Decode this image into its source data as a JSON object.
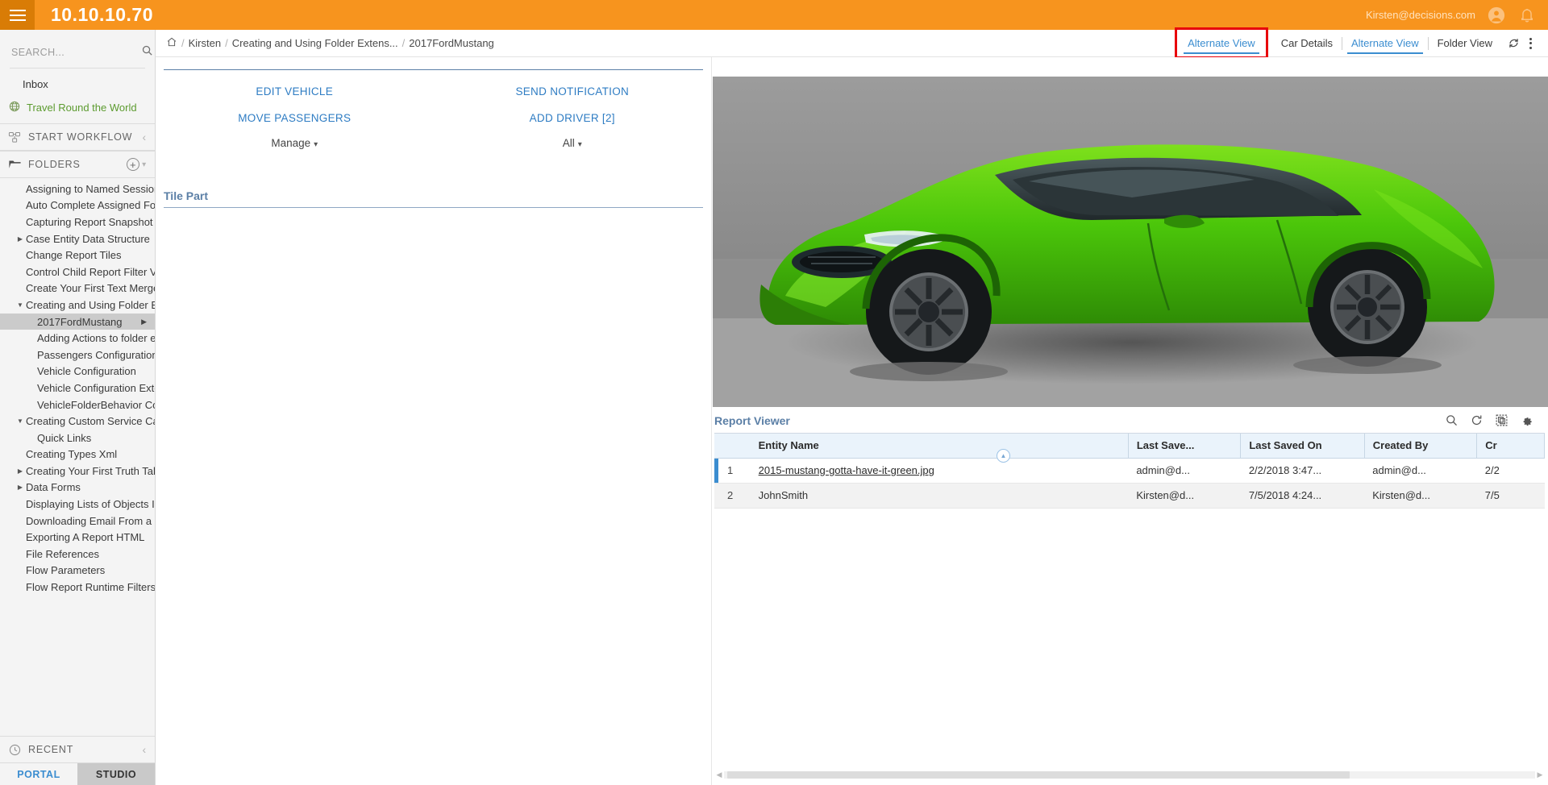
{
  "topbar": {
    "host": "10.10.10.70",
    "user_email": "Kirsten@decisions.com",
    "menu_icon": "hamburger-icon",
    "account_icon": "account-circle-icon",
    "bell_icon": "notification-bell-icon",
    "bg_color": "#F7941E"
  },
  "sidebar": {
    "search": {
      "placeholder": "SEARCH...",
      "value": ""
    },
    "inbox_label": "Inbox",
    "featured_label": "Travel Round the World",
    "start_workflow_label": "START WORKFLOW",
    "folders_label": "FOLDERS",
    "recent_label": "RECENT",
    "folders": [
      {
        "label": "Assigning to Named Sessions",
        "level": 0,
        "twisty": "",
        "selected": false
      },
      {
        "label": "Auto Complete Assigned Form",
        "level": 0,
        "twisty": "",
        "selected": false
      },
      {
        "label": "Capturing Report Snapshot",
        "level": 0,
        "twisty": "",
        "selected": false
      },
      {
        "label": "Case Entity Data Structure",
        "level": 0,
        "twisty": "collapsed",
        "selected": false
      },
      {
        "label": "Change Report Tiles",
        "level": 0,
        "twisty": "",
        "selected": false
      },
      {
        "label": "Control Child Report Filter Value",
        "level": 0,
        "twisty": "",
        "selected": false
      },
      {
        "label": "Create Your First Text Merge",
        "level": 0,
        "twisty": "",
        "selected": false
      },
      {
        "label": "Creating and Using Folder Exten",
        "level": 0,
        "twisty": "expanded",
        "selected": false
      },
      {
        "label": "2017FordMustang",
        "level": 1,
        "twisty": "",
        "selected": true,
        "right_arrow": true
      },
      {
        "label": "Adding Actions to folder entiti",
        "level": 1,
        "twisty": "",
        "selected": false
      },
      {
        "label": "Passengers Configuration",
        "level": 1,
        "twisty": "",
        "selected": false
      },
      {
        "label": "Vehicle Configuration",
        "level": 1,
        "twisty": "",
        "selected": false
      },
      {
        "label": "Vehicle Configuration Extensio",
        "level": 1,
        "twisty": "",
        "selected": false
      },
      {
        "label": "VehicleFolderBehavior Config",
        "level": 1,
        "twisty": "",
        "selected": false
      },
      {
        "label": "Creating Custom Service Catalo",
        "level": 0,
        "twisty": "expanded",
        "selected": false
      },
      {
        "label": "Quick Links",
        "level": 1,
        "twisty": "",
        "selected": false
      },
      {
        "label": "Creating Types Xml",
        "level": 0,
        "twisty": "",
        "selected": false
      },
      {
        "label": "Creating Your First Truth Table",
        "level": 0,
        "twisty": "collapsed",
        "selected": false
      },
      {
        "label": "Data Forms",
        "level": 0,
        "twisty": "collapsed",
        "selected": false
      },
      {
        "label": "Displaying Lists of Objects In A",
        "level": 0,
        "twisty": "",
        "selected": false
      },
      {
        "label": "Downloading Email From a Mail",
        "level": 0,
        "twisty": "",
        "selected": false
      },
      {
        "label": "Exporting A Report HTML",
        "level": 0,
        "twisty": "",
        "selected": false
      },
      {
        "label": "File References",
        "level": 0,
        "twisty": "",
        "selected": false
      },
      {
        "label": "Flow Parameters",
        "level": 0,
        "twisty": "",
        "selected": false
      },
      {
        "label": "Flow Report Runtime Filters",
        "level": 0,
        "twisty": "",
        "selected": false
      }
    ],
    "bottom_tabs": [
      {
        "label": "PORTAL",
        "active": true
      },
      {
        "label": "STUDIO",
        "active": false
      }
    ]
  },
  "breadcrumb": {
    "home_icon": "home-icon",
    "items": [
      "Kirsten",
      "Creating and Using Folder Extens...",
      "2017FordMustang"
    ]
  },
  "view_tabs": {
    "highlighted": {
      "label": "Alternate View",
      "highlight_color": "#E8000B"
    },
    "tabs": [
      {
        "label": "Car Details",
        "active": false
      },
      {
        "label": "Alternate View",
        "active": true
      },
      {
        "label": "Folder View",
        "active": false
      }
    ],
    "refresh_icon": "refresh-icon",
    "more_icon": "kebab-menu-icon"
  },
  "actions": {
    "left": [
      {
        "label": "EDIT VEHICLE"
      },
      {
        "label": "MOVE PASSENGERS"
      }
    ],
    "right": [
      {
        "label": "SEND NOTIFICATION"
      },
      {
        "label": "ADD DRIVER [2]"
      }
    ],
    "left_dropdown": "Manage",
    "right_dropdown": "All"
  },
  "tile_part": {
    "title": "Tile Part"
  },
  "car_image": {
    "alt_name": "green-ford-mustang-photo"
  },
  "report_viewer": {
    "title": "Report Viewer",
    "tools": [
      {
        "name": "search-icon"
      },
      {
        "name": "refresh-icon"
      },
      {
        "name": "copy-icon"
      },
      {
        "name": "gear-icon"
      }
    ],
    "columns": [
      "",
      "Entity Name",
      "Last Save...",
      "Last Saved On",
      "Created By",
      "Cr"
    ],
    "rows": [
      {
        "index": "1",
        "entity_name": "2015-mustang-gotta-have-it-green.jpg",
        "is_link": true,
        "last_saved_by": "admin@d...",
        "last_saved_on": "2/2/2018 3:47...",
        "created_by": "admin@d...",
        "created_on": "2/2"
      },
      {
        "index": "2",
        "entity_name": "JohnSmith",
        "is_link": false,
        "last_saved_by": "Kirsten@d...",
        "last_saved_on": "7/5/2018 4:24...",
        "created_by": "Kirsten@d...",
        "created_on": "7/5"
      }
    ]
  }
}
